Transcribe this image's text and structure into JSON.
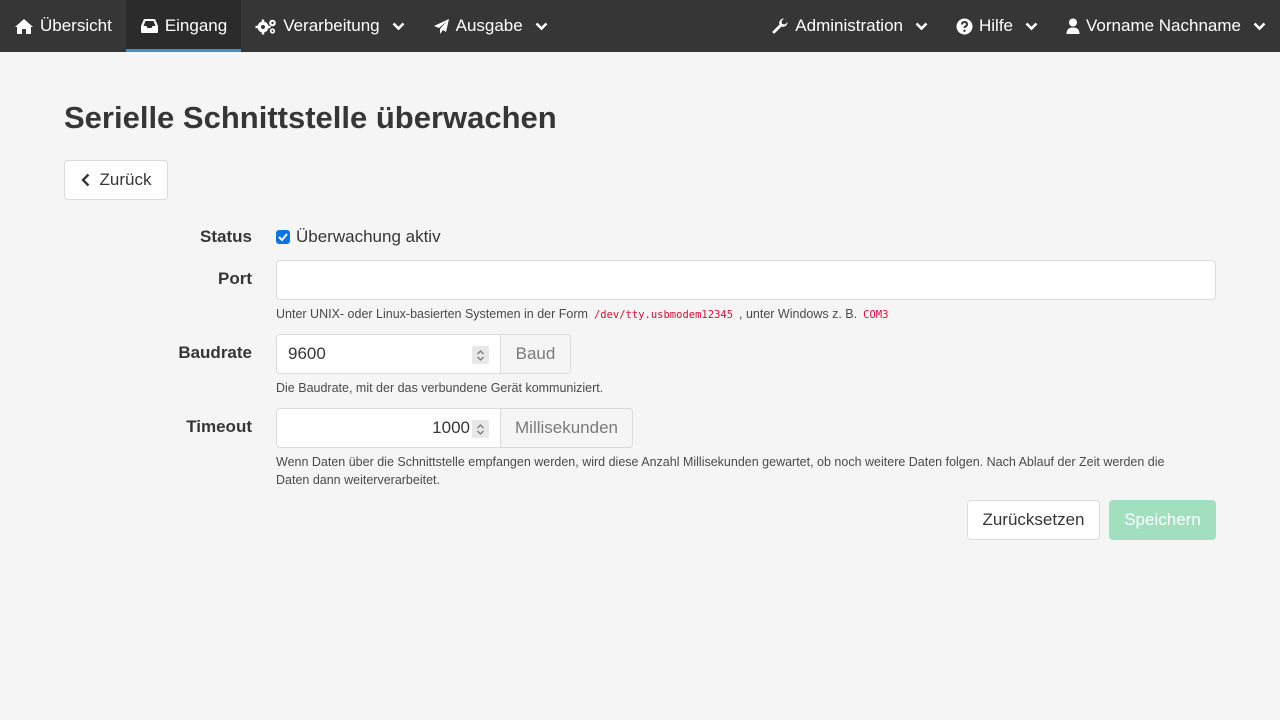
{
  "nav": {
    "overview": "Übersicht",
    "input": "Eingang",
    "processing": "Verarbeitung",
    "output": "Ausgabe",
    "administration": "Administration",
    "help": "Hilfe",
    "user": "Vorname Nachname"
  },
  "page": {
    "title": "Serielle Schnittstelle überwachen",
    "back_label": "Zurück"
  },
  "form": {
    "status": {
      "label": "Status",
      "checkbox_label": "Überwachung aktiv",
      "checked": true
    },
    "port": {
      "label": "Port",
      "value": "",
      "help_prefix": "Unter UNIX- oder Linux-basierten Systemen in der Form",
      "help_code_unix": "/dev/tty.usbmodem12345",
      "help_middle": ", unter Windows z. B.",
      "help_code_windows": "COM3"
    },
    "baudrate": {
      "label": "Baudrate",
      "value": "9600",
      "unit": "Baud",
      "help": "Die Baudrate, mit der das verbundene Gerät kommuniziert."
    },
    "timeout": {
      "label": "Timeout",
      "value": "1000",
      "unit": "Millisekunden",
      "help": "Wenn Daten über die Schnittstelle empfangen werden, wird diese Anzahl Millisekunden gewartet, ob noch weitere Daten folgen. Nach Ablauf der Zeit werden die Daten dann weiterverarbeitet."
    },
    "reset_label": "Zurücksetzen",
    "save_label": "Speichern"
  },
  "colors": {
    "navbar": "#363636",
    "active_underline": "#3e8ed0",
    "checkbox": "#0b74e5",
    "save_disabled": "#a2dfbf",
    "code": "#da1039"
  }
}
